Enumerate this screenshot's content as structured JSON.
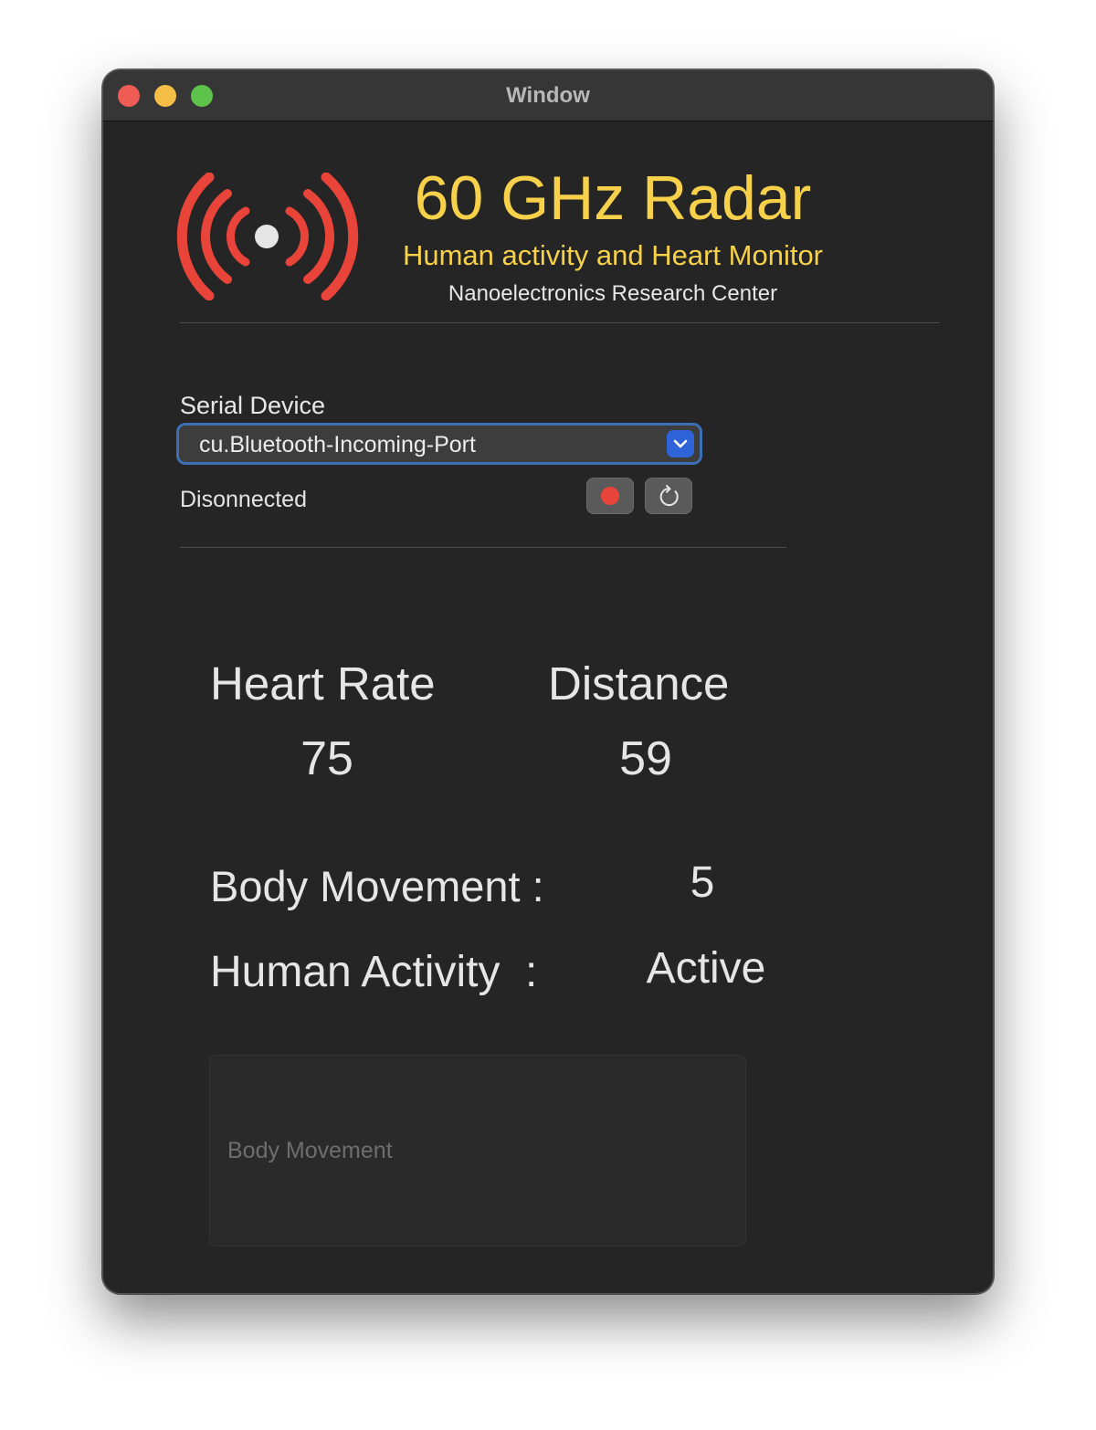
{
  "window": {
    "title": "Window"
  },
  "header": {
    "icon": "radio-waves-icon",
    "title": "60 GHz Radar",
    "subtitle": "Human activity and Heart Monitor",
    "organization": "Nanoelectronics Research Center"
  },
  "serial": {
    "label": "Serial Device",
    "selected_device": "cu.Bluetooth-Incoming-Port",
    "status": "Disonnected"
  },
  "metrics": {
    "heart_rate_label": "Heart Rate",
    "heart_rate_value": "75",
    "distance_label": "Distance",
    "distance_value": "59",
    "body_movement_label": "Body Movement :",
    "body_movement_value": "5",
    "human_activity_label": "Human Activity",
    "human_activity_colon": ":",
    "human_activity_value": "Active"
  },
  "chart": {
    "placeholder": "Body Movement"
  },
  "colors": {
    "accent_yellow": "#f7d14a",
    "icon_red": "#e8443a",
    "select_border": "#3d6fb4",
    "select_arrow": "#2f64d8",
    "window_bg": "#252525"
  }
}
